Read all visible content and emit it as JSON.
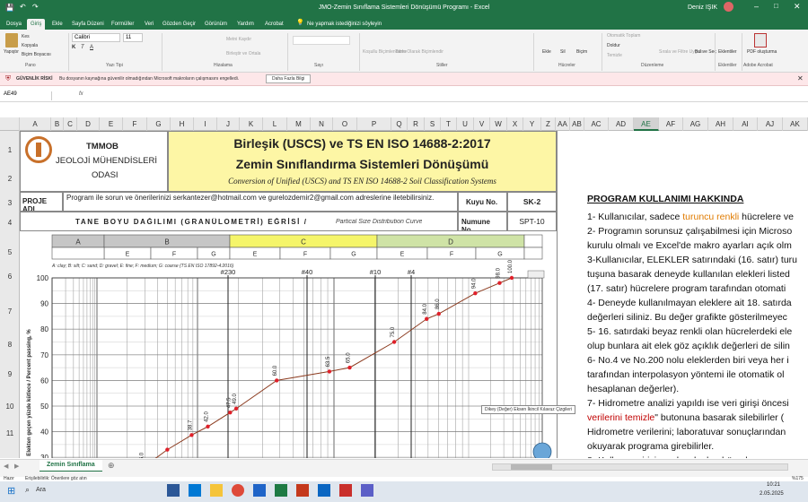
{
  "window": {
    "title": "JMO-Zemin Sınıflama Sistemleri Dönüşümü Programı  -  Excel",
    "user": "Deniz IŞIK"
  },
  "tabs": [
    "Dosya",
    "Giriş",
    "Ekle",
    "Sayfa Düzeni",
    "Formüller",
    "Veri",
    "Gözden Geçir",
    "Görünüm",
    "Yardım",
    "Acrobat"
  ],
  "tell_me": "Ne yapmak istediğinizi söyleyin",
  "ribbon": {
    "paste": "Yapıştır",
    "cut": "Kes",
    "copy": "Kopyala",
    "format_painter": "Biçim Boyacısı",
    "font_name": "Calibri",
    "font_size": "11",
    "wrap": "Metni Kaydır",
    "merge": "Birleştir ve Ortala",
    "cond_format": "Koşullu Biçimlendirme",
    "as_table": "Tablo Olarak Biçimlendir",
    "insert": "Ekle",
    "delete": "Sil",
    "format": "Biçim",
    "autosum": "Otomatik Toplam",
    "fill": "Doldur",
    "clear": "Temizle",
    "sort": "Sırala ve Filtre Uygula",
    "find": "Bul ve Seç",
    "addins": "Eklentiler",
    "pdf": "PDF oluşturma",
    "groups": [
      "Pano",
      "Yazı Tipi",
      "Hizalama",
      "Sayı",
      "Stiller",
      "Hücreler",
      "Düzenleme",
      "Eklentiler",
      "Adobe Acrobat"
    ]
  },
  "security": {
    "label": "GÜVENLİK RİSKİ",
    "message": "Bu dosyanın kaynağına güvenilir olmadığından Microsoft makroların çalışmasını engelledi.",
    "button": "Daha Fazla Bilgi"
  },
  "name_box": "AE49",
  "fx": "fx",
  "columns": [
    "A",
    "B",
    "C",
    "D",
    "E",
    "F",
    "G",
    "H",
    "I",
    "J",
    "K",
    "L",
    "M",
    "N",
    "O",
    "P",
    "Q",
    "R",
    "S",
    "T",
    "U",
    "V",
    "W",
    "X",
    "Y",
    "Z",
    "AA",
    "AB",
    "AC",
    "AD",
    "AE",
    "AF",
    "AG",
    "AH",
    "AI",
    "AJ",
    "AK"
  ],
  "rows": [
    "1",
    "2",
    "3",
    "4",
    "5",
    "6",
    "7",
    "8",
    "9",
    "10",
    "11"
  ],
  "sheet": {
    "org1": "TMMOB",
    "org2": "JEOLOJİ MÜHENDİSLERİ",
    "org3": "ODASI",
    "title1": "Birleşik (USCS) ve TS EN ISO 14688-2:2017",
    "title2": "Zemin Sınıflandırma Sistemleri Dönüşümü",
    "subtitle": "Conversion of Unified (USCS) and TS EN ISO 14688-2 Soil Classification Systems",
    "proje_label": "PROJE ADI",
    "proje_text": "Program ile sorun ve önerilerinizi serkantezer@hotmail.com ve gurelozdemir2@gmail.com adreslerine iletebilirsiniz.",
    "kuyu_label": "Kuyu No.",
    "kuyu_value": "SK-2",
    "numune_label": "Numune No.",
    "numune_value": "SPT-10",
    "grading_title": "TANE BOYU DAĞILIMI (GRANÜLOMETRİ) EĞRİSİ /",
    "grading_en": "Partical Size Distribution Curve"
  },
  "chart_data": {
    "type": "line",
    "zones": [
      "A",
      "B",
      "C",
      "D"
    ],
    "subzones": [
      "E",
      "F",
      "G",
      "E",
      "F",
      "G",
      "E",
      "F",
      "G"
    ],
    "legend_text": "A: clay; B: silt; C: sand; D: gravel; E: fine; F: medium; G: coarse (TS EN ISO 17892-4:2016)",
    "ylabel": "Elekten geçen yüzde kütlece / Percent passing, %",
    "y_ticks": [
      100,
      90,
      80,
      70,
      60,
      50,
      40,
      30,
      20
    ],
    "sieve_marks": [
      "#230",
      "#40",
      "#10",
      "#4"
    ],
    "ylim": [
      20,
      100
    ],
    "colors": {
      "line": "#8b3a1e",
      "point": "#e0202a",
      "zoneA": "#c6c6c6",
      "zoneB": "#c6c6c6",
      "zoneC": "#f5f56a",
      "zoneD": "#cfe3a6"
    },
    "points": [
      {
        "x": 0.4,
        "y": 17.0,
        "label": "17.0"
      },
      {
        "x": 0.46,
        "y": 21.1,
        "label": "21.1"
      },
      {
        "x": 0.52,
        "y": 26.0,
        "label": "26.0"
      },
      {
        "x": 0.58,
        "y": 33.0,
        "label": ""
      },
      {
        "x": 0.64,
        "y": 38.7,
        "label": "38.7"
      },
      {
        "x": 0.68,
        "y": 42.0,
        "label": "42.0"
      },
      {
        "x": 0.735,
        "y": 47.5,
        "label": "47.5"
      },
      {
        "x": 0.75,
        "y": 49.0,
        "label": "49.0"
      },
      {
        "x": 0.85,
        "y": 60.0,
        "label": "60.0"
      },
      {
        "x": 0.98,
        "y": 63.5,
        "label": "63.5"
      },
      {
        "x": 1.03,
        "y": 65.0,
        "label": "65.0"
      },
      {
        "x": 1.14,
        "y": 75.0,
        "label": "75.0"
      },
      {
        "x": 1.22,
        "y": 84.0,
        "label": "84.0"
      },
      {
        "x": 1.25,
        "y": 86.0,
        "label": "86.0"
      },
      {
        "x": 1.34,
        "y": 94.0,
        "label": "94.0"
      },
      {
        "x": 1.4,
        "y": 98.0,
        "label": "98.0"
      },
      {
        "x": 1.43,
        "y": 100.0,
        "label": "100.0"
      }
    ]
  },
  "tooltip": "Dikey (Değer) Eksen İkincil Kılavuz Çizgileri",
  "program_info": {
    "heading": "PROGRAM KULLANIMI HAKKINDA",
    "lines": [
      "1- Kullanıcılar, sadece turuncu renkli hücrelere ve",
      "2- Programın sorunsuz çalışabilmesi için Microso",
      "kurulu olmalı ve Excel'de makro ayarları açık olm",
      "3-Kullanıcılar, ELEKLER satırındaki (16. satır) turu",
      "tuşuna basarak deneyde kullanılan elekleri listed",
      "(17. satır) hücrelere program tarafından otomati",
      "4- Deneyde kullanılmayan eleklere ait 18. satırda",
      "değerleri siliniz. Bu değer grafikte gösterilmeyec",
      "5- 16. satırdaki beyaz renkli olan hücrelerdeki ele",
      "olup bunlara ait elek göz açıklık değerleri de silin",
      "6- No.4 ve No.200 nolu eleklerden biri veya her i",
      "tarafından interpolasyon yöntemi ile otomatik ol",
      "hesaplanan değerler).",
      "7- Hidrometre analizi yapıldı ise veri girişi öncesi",
      "verilerini temizle\" butonuna basarak silebilirler (",
      "Hidrometre verilerini; laboratuvar sonuçlarından",
      "okuyarak programa girebilirler.",
      "8- Kullanıcı girişi yapılacak olan hücrel"
    ]
  },
  "sheet_tab": "Zemin Sınıflama",
  "status": {
    "left": "Hazır",
    "accessibility": "Erişilebilirlik: Önerilere göz atın",
    "zoom": "%175"
  },
  "taskbar": {
    "search": "Ara",
    "time": "10:21",
    "date": "2.05.2025"
  }
}
